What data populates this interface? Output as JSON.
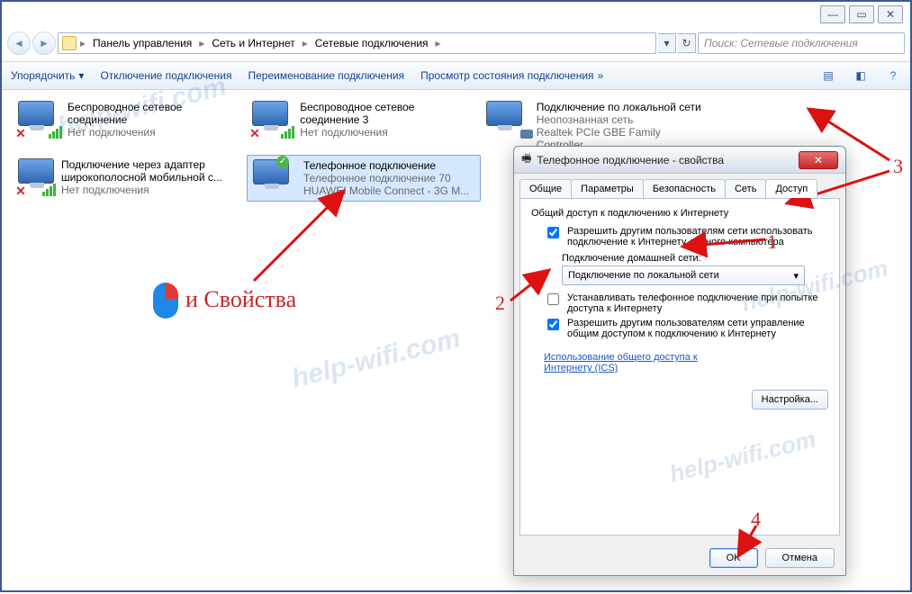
{
  "window_controls": {
    "min": "—",
    "max": "▭",
    "close": "✕"
  },
  "breadcrumbs": {
    "root": "Панель управления",
    "mid": "Сеть и Интернет",
    "leaf": "Сетевые подключения"
  },
  "search": {
    "placeholder": "Поиск: Сетевые подключения"
  },
  "toolbar": {
    "organize": "Упорядочить",
    "disable": "Отключение подключения",
    "rename": "Переименование подключения",
    "status": "Просмотр состояния подключения"
  },
  "connections": [
    {
      "title": "Беспроводное сетевое соединение",
      "sub1": "Нет подключения",
      "type": "wifi-off"
    },
    {
      "title": "Беспроводное сетевое соединение 3",
      "sub1": "Нет подключения",
      "type": "wifi-off"
    },
    {
      "title": "Подключение по локальной сети",
      "sub1": "Неопознанная сеть",
      "sub2": "Realtek PCIe GBE Family Controller",
      "type": "lan"
    },
    {
      "title": "Подключение через адаптер широкополосной мобильной с...",
      "sub1": "Нет подключения",
      "type": "wifi-off"
    },
    {
      "title": "Телефонное подключение",
      "sub1": "Телефонное подключение  70",
      "sub2": "HUAWEI Mobile Connect - 3G M...",
      "type": "phone-on",
      "selected": true
    }
  ],
  "dialog": {
    "title": "Телефонное подключение - свойства",
    "tabs": {
      "general": "Общие",
      "params": "Параметры",
      "security": "Безопасность",
      "network": "Сеть",
      "access": "Доступ"
    },
    "group": "Общий доступ к подключению к Интернету",
    "chk1": "Разрешить другим пользователям сети использовать подключение к Интернету данного компьютера",
    "home_label": "Подключение домашней сети:",
    "combo": "Подключение по локальной сети",
    "chk2": "Устанавливать телефонное подключение при попытке доступа к Интернету",
    "chk3": "Разрешить другим пользователям сети управление общим доступом к подключению к Интернету",
    "link": "Использование общего доступа к Интернету (ICS)",
    "settings_btn": "Настройка...",
    "ok": "OK",
    "cancel": "Отмена"
  },
  "annot": {
    "props": "и Свойства",
    "n1": "1",
    "n2": "2",
    "n3": "3",
    "n4": "4"
  },
  "watermark": "help-wifi.com"
}
